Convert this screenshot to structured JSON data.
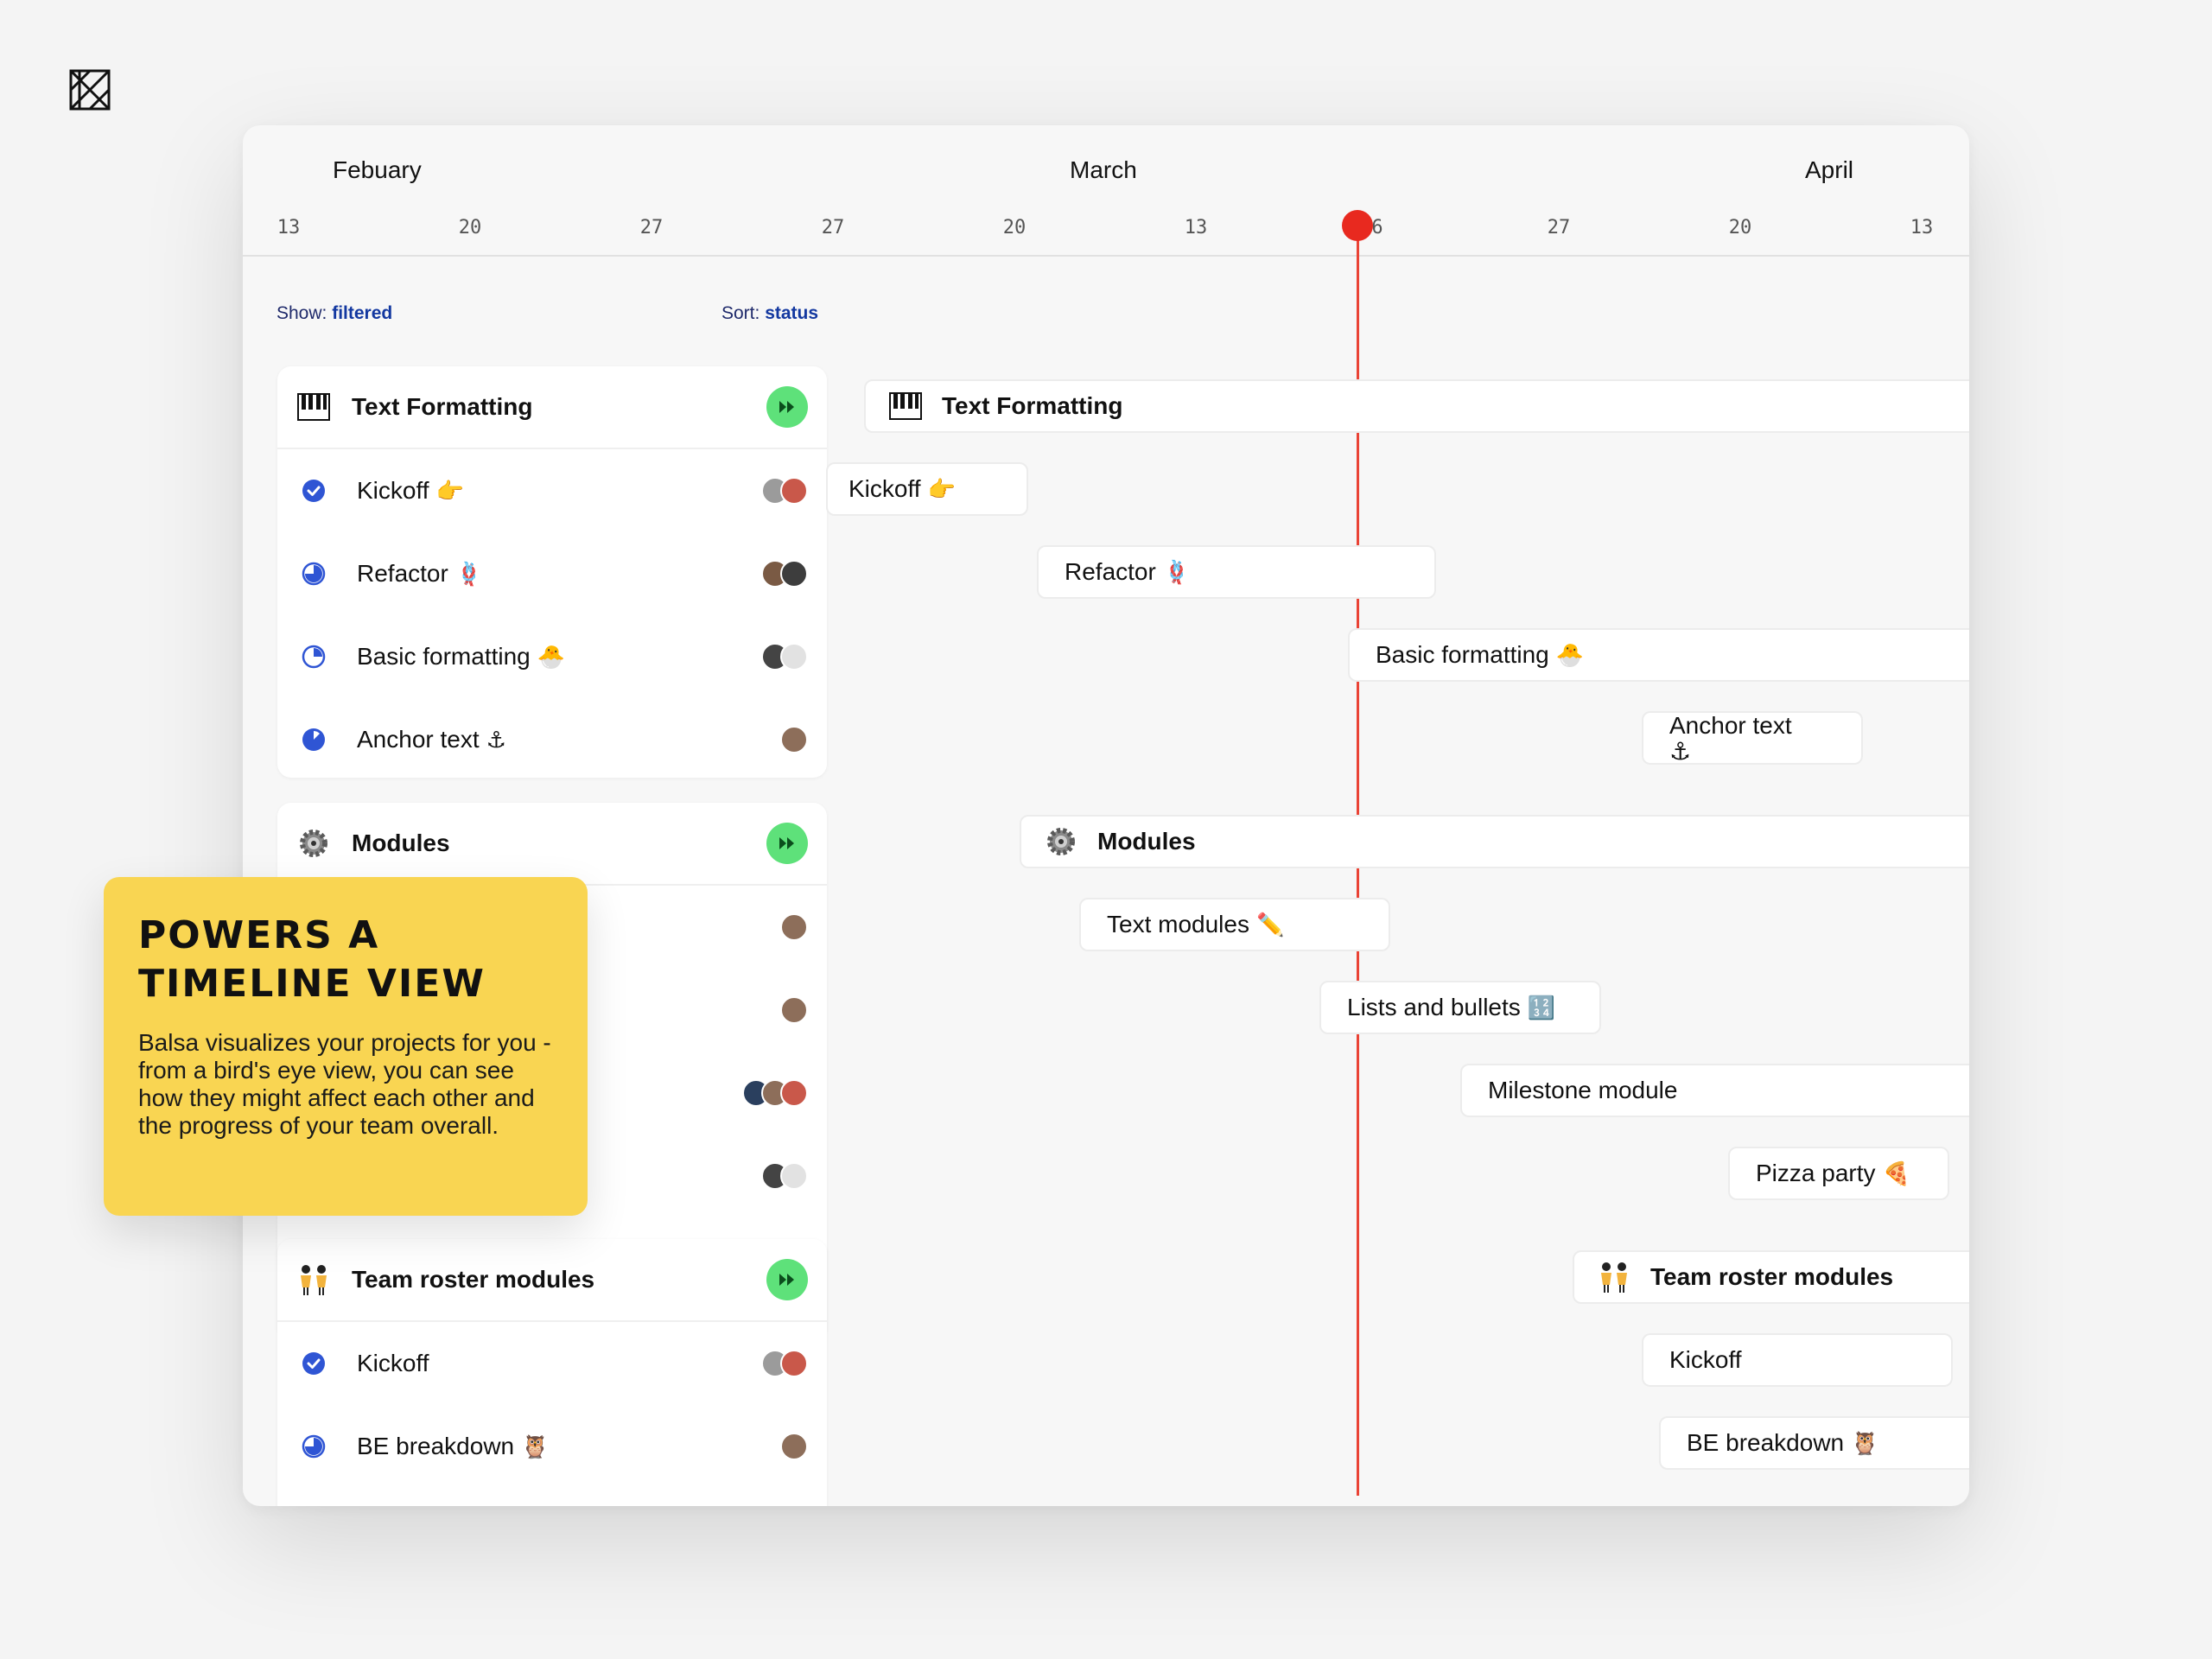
{
  "timeline": {
    "months": [
      "Febuary",
      "March",
      "April"
    ],
    "days": [
      "13",
      "20",
      "27",
      "27",
      "20",
      "13",
      "6",
      "27",
      "20",
      "13"
    ]
  },
  "controls": {
    "show_label": "Show:",
    "show_value": "filtered",
    "sort_label": "Sort:",
    "sort_value": "status"
  },
  "groups": [
    {
      "title": "Text Formatting",
      "icon": "piano-icon",
      "tasks": [
        {
          "label": "Kickoff",
          "emoji": "👉",
          "status": "complete"
        },
        {
          "label": "Refactor",
          "emoji": "🪢",
          "status": "in-progress-half"
        },
        {
          "label": "Basic formatting",
          "emoji": "🐣",
          "status": "in-progress-quarter"
        },
        {
          "label": "Anchor text",
          "emoji": "⚓",
          "status": "in-progress-eighth"
        }
      ]
    },
    {
      "title": "Modules",
      "icon": "gear-icon",
      "tasks": [
        {
          "label": "Text modules",
          "emoji": "✏️"
        },
        {
          "label": "Lists and bullets",
          "emoji": "🔢"
        },
        {
          "label": "Milestone module",
          "emoji": ""
        },
        {
          "label": "Pizza party",
          "emoji": "🍕"
        }
      ]
    },
    {
      "title": "Team roster modules",
      "icon": "dancers-icon",
      "tasks": [
        {
          "label": "Kickoff",
          "emoji": "",
          "status": "complete"
        },
        {
          "label": "BE breakdown",
          "emoji": "🦉",
          "status": "in-progress-half"
        }
      ]
    }
  ],
  "callout": {
    "title": "Powers a timeline view",
    "body": "Balsa visualizes your projects for you - from a bird's eye view, you can see how they might affect each other and the progress of your team overall."
  },
  "colors": {
    "accent": "#2f55d4",
    "play": "#5ee17a",
    "now_line": "#ea4335",
    "callout": "#f9d552"
  }
}
